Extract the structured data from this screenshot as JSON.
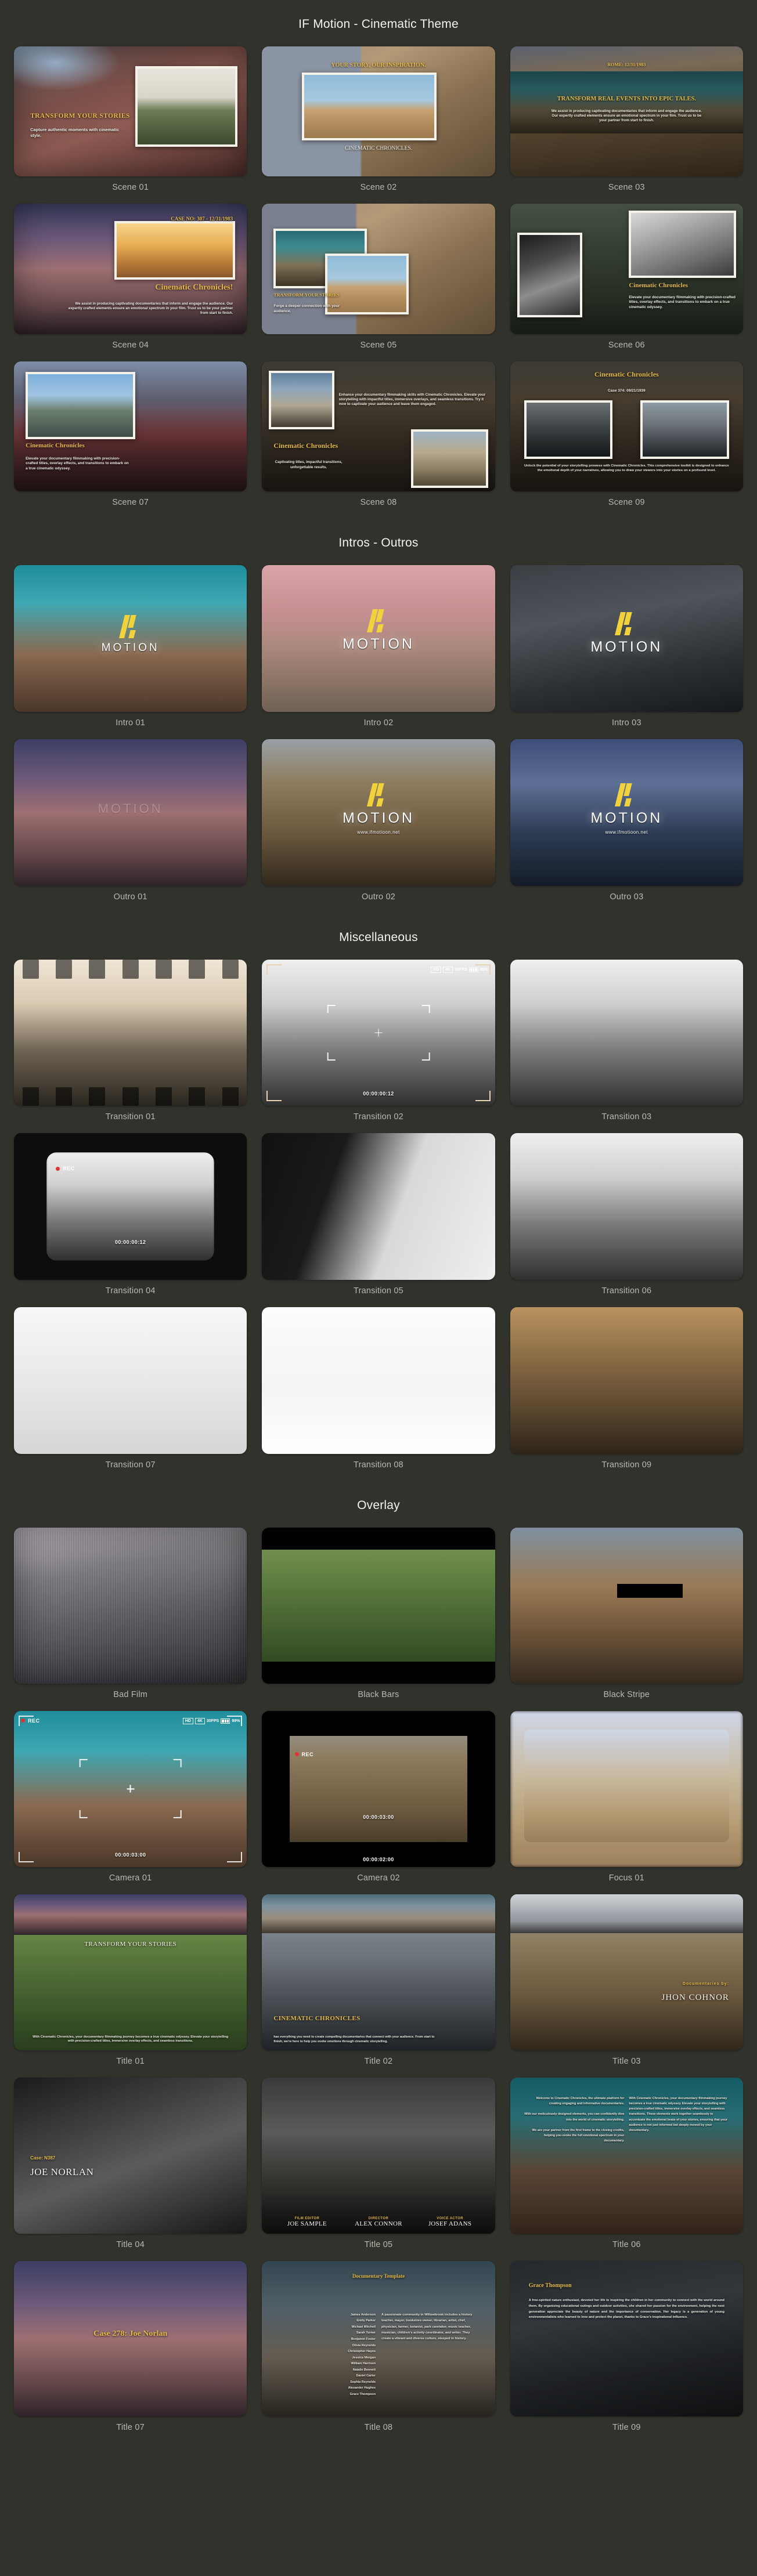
{
  "sections": [
    {
      "title": "IF Motion - Cinematic Theme",
      "items": [
        {
          "caption": "Scene 01",
          "headline": "TRANSFORM YOUR STORIES",
          "body": "Capture authentic moments with cinematic style."
        },
        {
          "caption": "Scene 02",
          "headline": "YOUR STORY, OUR INSPIRATION.",
          "subhead": "CINEMATIC CHRONICLES."
        },
        {
          "caption": "Scene 03",
          "eyebrow": "ROME: 12/31/1983",
          "headline": "TRANSFORM REAL EVENTS INTO EPIC TALES.",
          "body": "We assist in producing captivating documentaries that inform and engage the audience. Our expertly crafted elements ensure an emotional spectrum in your film. Trust us to be your partner from start to finish."
        },
        {
          "caption": "Scene 04",
          "eyebrow": "CASE NO: 307 - 12/31/1983",
          "headline": "Cinematic Chronicles!",
          "body": "We assist in producing captivating documentaries that inform and engage the audience. Our expertly crafted elements ensure an emotional spectrum in your film. Trust us to be your partner from start to finish."
        },
        {
          "caption": "Scene 05",
          "headline": "TRANSFORM YOUR STORIES",
          "body": "Forge a deeper connection with your audience."
        },
        {
          "caption": "Scene 06",
          "headline": "Cinematic Chronicles",
          "body": "Elevate your documentary filmmaking with precision-crafted titles, overlay effects, and transitions to embark on a true cinematic odyssey."
        },
        {
          "caption": "Scene 07",
          "headline": "Cinematic Chronicles",
          "body": "Elevate your documentary filmmaking with precision-crafted titles, overlay effects, and transitions to embark on a true cinematic odyssey."
        },
        {
          "caption": "Scene 08",
          "headline": "Cinematic Chronicles",
          "body": "Captivating titles, impactful transitions, unforgettable results.",
          "body2": "Enhance your documentary filmmaking skills with Cinematic Chronicles. Elevate your storytelling with impactful titles, immersive overlays, and seamless transitions. Try it now to captivate your audience and leave them engaged."
        },
        {
          "caption": "Scene 09",
          "headline": "Cinematic Chronicles",
          "eyebrow": "Case 374: 09/21/1939",
          "body": "Unlock the potential of your storytelling prowess with Cinematic Chronicles. This comprehensive toolkit is designed to enhance the emotional depth of your narratives, allowing you to draw your viewers into your stories on a profound level."
        }
      ]
    },
    {
      "title": "Intros - Outros",
      "items": [
        {
          "caption": "Intro 01",
          "logo_text": "MOTION"
        },
        {
          "caption": "Intro 02",
          "logo_text": "MOTION"
        },
        {
          "caption": "Intro 03",
          "logo_text": "MOTION"
        },
        {
          "caption": "Outro 01",
          "logo_text": "MOTION"
        },
        {
          "caption": "Outro 02",
          "logo_text": "MOTION",
          "url": "www.ifmotioon.net"
        },
        {
          "caption": "Outro 03",
          "logo_text": "MOTION",
          "url": "www.ifmotioon.net"
        }
      ]
    },
    {
      "title": "Miscellaneous",
      "items": [
        {
          "caption": "Transition 01"
        },
        {
          "caption": "Transition 02",
          "hud": {
            "hd": "HD",
            "res": "4K",
            "fps": "30FPS",
            "battery": "99%",
            "timecode": "00:00:00:12"
          }
        },
        {
          "caption": "Transition 03"
        },
        {
          "caption": "Transition 04",
          "hud": {
            "rec": "REC",
            "timecode": "00:00:00:12"
          }
        },
        {
          "caption": "Transition 05"
        },
        {
          "caption": "Transition 06"
        },
        {
          "caption": "Transition 07"
        },
        {
          "caption": "Transition 08"
        },
        {
          "caption": "Transition 09"
        }
      ]
    },
    {
      "title": "Overlay",
      "items": [
        {
          "caption": "Bad Film"
        },
        {
          "caption": "Black Bars"
        },
        {
          "caption": "Black Stripe"
        },
        {
          "caption": "Camera 01",
          "hud": {
            "rec": "REC",
            "hd": "HD",
            "res": "4K",
            "fps": "30FPS",
            "battery": "99%",
            "timecode": "00:00:03:00"
          }
        },
        {
          "caption": "Camera 02",
          "hud": {
            "rec": "REC",
            "timecode": "00:00:03:00",
            "timecode2": "00:00:02:00"
          }
        },
        {
          "caption": "Focus 01"
        },
        {
          "caption": "Title 01",
          "headline": "TRANSFORM YOUR STORIES",
          "body": "With Cinematic Chronicles, your documentary filmmaking journey becomes a true cinematic odyssey. Elevate your storytelling with precision-crafted titles, immersive overlay effects, and seamless transitions."
        },
        {
          "caption": "Title 02",
          "headline": "CINEMATIC CHRONICLES",
          "body": "has everything you need to create compelling documentaries that connect with your audience. From start to finish, we're here to help you evoke emotions through cinematic storytelling."
        },
        {
          "caption": "Title 03",
          "eyebrow": "Documentaries by:",
          "headline": "JHON COHNOR"
        },
        {
          "caption": "Title 04",
          "eyebrow": "Case: N387",
          "headline": "JOE NORLAN"
        },
        {
          "caption": "Title 05",
          "credits": [
            {
              "role": "FILM EDITOR",
              "name": "JOE SAMPLE"
            },
            {
              "role": "DIRECTOR",
              "name": "ALEX CONNOR"
            },
            {
              "role": "VOICE ACTOR",
              "name": "JOSEF ADANS"
            }
          ]
        },
        {
          "caption": "Title 06",
          "col1": "Welcome to Cinematic Chronicles, the ultimate platform for creating engaging and informative documentaries.\n\nWith our meticulously designed elements, you can confidently dive into the world of cinematic storytelling.\n\nWe are your partner from the first frame to the closing credits, helping you evoke the full emotional spectrum in your documentary.",
          "col2": "With Cinematic Chronicles, your documentary filmmaking journey becomes a true cinematic odyssey. Elevate your storytelling with precision-crafted titles, immersive overlay effects, and seamless transitions. These elements work together seamlessly to accentuate the emotional beats of your stories, ensuring that your audience is not just informed but deeply moved by your documentary."
        },
        {
          "caption": "Title 07",
          "headline": "Case 278: Joe Norlan"
        },
        {
          "caption": "Title 08",
          "headline": "Documentary Template",
          "names": [
            "James Anderson",
            "Emily Parker",
            "Michael Mitchell",
            "Sarah Turner",
            "Benjamin Foster",
            "Olivia Reynolds",
            "Christopher Hayes",
            "Jessica Morgan",
            "William Harrison",
            "Natalie Bennett",
            "Daniel Carter",
            "Sophia Reynolds",
            "Alexander Hughes",
            "Grace Thompson"
          ],
          "body": "A passionate community in Willowbrook includes a history teacher, mayor, bookstore owner, librarian, artist, chef, physician, farmer, botanist, park caretaker, music teacher, musician, children's activity coordinator, and writer. They create a vibrant and diverse culture, steeped in history."
        },
        {
          "caption": "Title 09",
          "headline": "Grace Thompson",
          "body": "A free-spirited nature enthusiast, devoted her life to inspiring the children in her community to connect with the world around them. By organizing educational outings and outdoor activities, she shared her passion for the environment, helping the next generation appreciate the beauty of nature and the importance of conservation. Her legacy is a generation of young environmentalists who learned to love and protect the planet, thanks to Grace's inspirational influence."
        }
      ]
    }
  ],
  "colors": {
    "background": "#31322c",
    "accent_gold": "#e3b949",
    "logo_yellow": "#f2d23c",
    "caption": "#b9b9b2"
  }
}
